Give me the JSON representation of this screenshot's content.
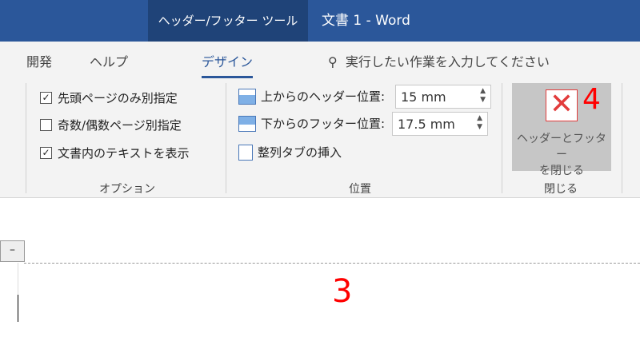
{
  "titlebar": {
    "context_tab": "ヘッダー/フッター ツール",
    "title": "文書 1  -  Word"
  },
  "tabs": [
    {
      "label": "開発"
    },
    {
      "label": "ヘルプ"
    },
    {
      "label": "デザイン",
      "active": true
    }
  ],
  "search": {
    "placeholder": "実行したい作業を入力してください"
  },
  "options": {
    "items": [
      {
        "label": "先頭ページのみ別指定",
        "checked": true
      },
      {
        "label": "奇数/偶数ページ別指定",
        "checked": false
      },
      {
        "label": "文書内のテキストを表示",
        "checked": true
      }
    ],
    "group": "オプション"
  },
  "position": {
    "header_label": "上からのヘッダー位置:",
    "header_value": "15 mm",
    "footer_label": "下からのフッター位置:",
    "footer_value": "17.5 mm",
    "align_tab": "整列タブの挿入",
    "group": "位置"
  },
  "close": {
    "line1": "ヘッダーとフッター",
    "line2": "を閉じる",
    "group": "閉じる",
    "annotation": "4"
  },
  "document": {
    "header_tag": "–",
    "annotation": "3"
  },
  "colors": {
    "accent": "#2b579a",
    "annotation": "#ff0000"
  }
}
